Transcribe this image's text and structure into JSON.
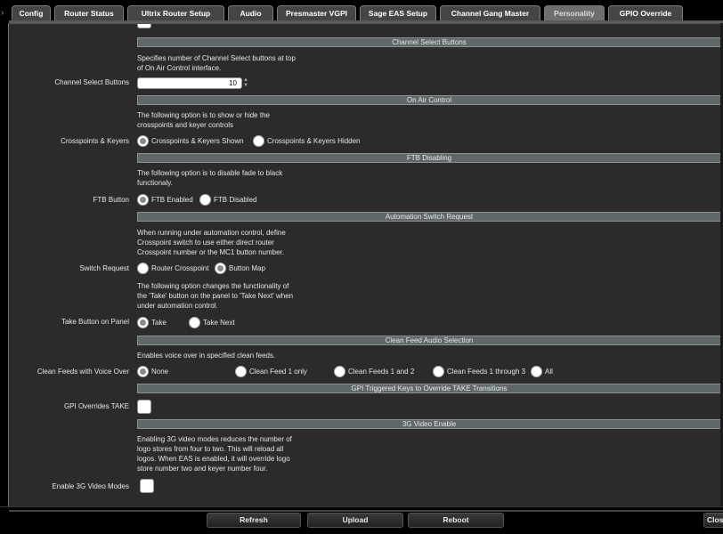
{
  "tabs": [
    {
      "label": "Config",
      "active": false
    },
    {
      "label": "Router Status",
      "active": false
    },
    {
      "label": "Ultrix Router Setup",
      "active": false
    },
    {
      "label": "Audio",
      "active": false
    },
    {
      "label": "Presmaster VGPI",
      "active": false
    },
    {
      "label": "Sage EAS Setup",
      "active": false
    },
    {
      "label": "Channel Gang Master",
      "active": false
    },
    {
      "label": "Personality",
      "active": true
    },
    {
      "label": "GPIO Override",
      "active": false
    }
  ],
  "sections": {
    "channel_select": {
      "header": "Channel Select Buttons",
      "desc1": "Specifies number of Channel Select buttons at top",
      "desc2": "of On Air Control interface.",
      "label": "Channel Select Buttons",
      "value": "10"
    },
    "on_air": {
      "header": "On Air Control",
      "desc1": "The following option is to show or hide the",
      "desc2": "crosspoints and keyer controls",
      "label": "Crosspoints & Keyers",
      "options": [
        "Crosspoints & Keyers Shown",
        "Crosspoints & Keyers Hidden"
      ],
      "selected": 0
    },
    "ftb": {
      "header": "FTB Disabling",
      "desc1": "The following option is to disable fade to black",
      "desc2": "functionaly.",
      "label": "FTB Button",
      "options": [
        "FTB Enabled",
        "FTB Disabled"
      ],
      "selected": 0
    },
    "automation": {
      "header": "Automation Switch Request",
      "desc1": "When running under automation control, define",
      "desc2": "Crosspoint switch to use either direct router",
      "desc3": "Crosspoint number or the MC1 button number.",
      "label": "Switch Request",
      "options": [
        "Router Crosspoint",
        "Button Map"
      ],
      "selected": 1
    },
    "take": {
      "desc1": "The following option changes the functionality of",
      "desc2": "the 'Take' button on the panel to 'Take Next' when",
      "desc3": "under automation control.",
      "label": "Take Button on Panel",
      "options": [
        "Take",
        "Take Next"
      ],
      "selected": 0
    },
    "clean_feed": {
      "header": "Clean Feed Audio Selection",
      "desc1": "Enables voice over in specified clean feeds.",
      "label": "Clean Feeds with Voice Over",
      "options": [
        "None",
        "Clean Feed 1 only",
        "Clean Feeds 1 and 2",
        "Clean Feeds 1 through 3",
        "All"
      ],
      "selected": 0
    },
    "gpi": {
      "header": "GPI Triggered Keys to Override TAKE Transitions",
      "label": "GPI Overrides TAKE"
    },
    "video3g": {
      "header": "3G Video Enable",
      "desc1": "Enabling 3G video modes reduces the number of",
      "desc2": "logo stores from four to two. This will reload all",
      "desc3": "logos. When EAS is enabled, it will override logo",
      "desc4": "store number two and keyer number four.",
      "label": "Enable 3G Video Modes"
    }
  },
  "footer": {
    "refresh": "Refresh",
    "upload": "Upload",
    "reboot": "Reboot",
    "close": "Close"
  },
  "icons": {
    "left_chevron": "›",
    "spin_up": "▲",
    "spin_down": "▼"
  }
}
